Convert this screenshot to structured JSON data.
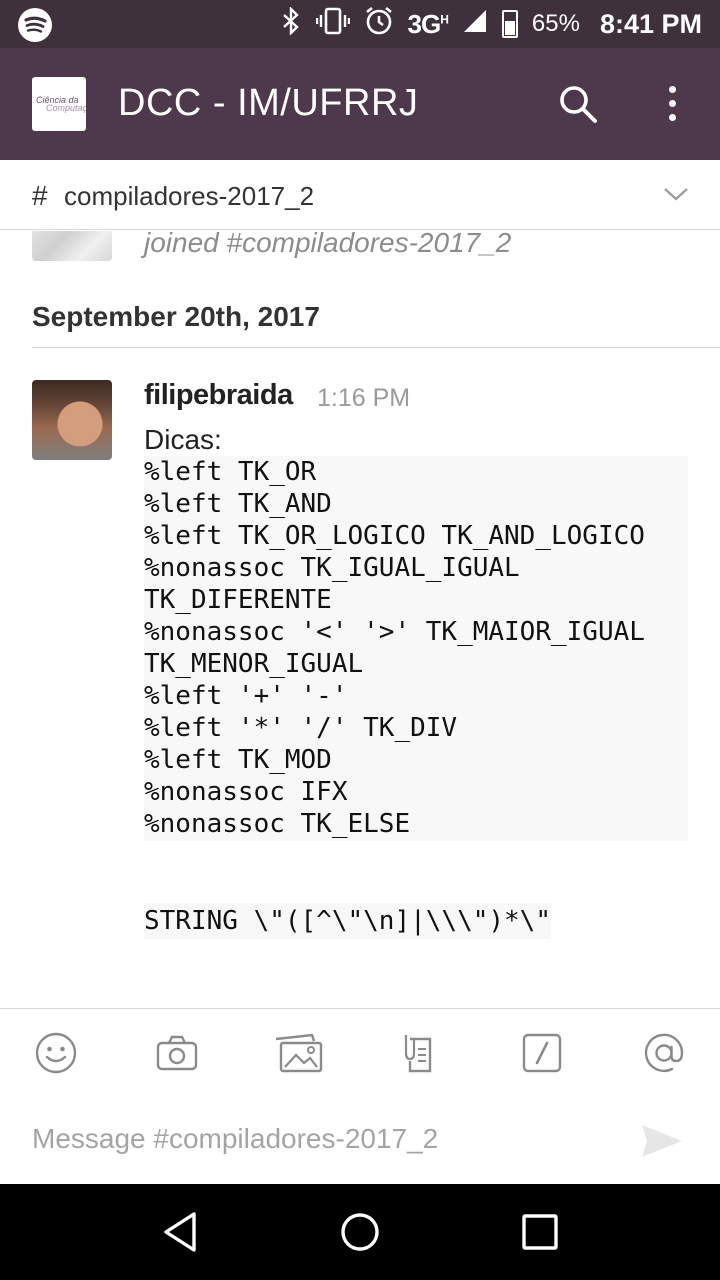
{
  "status_bar": {
    "network": "3G",
    "network_superscript": "H",
    "battery_percent": "65%",
    "time": "8:41 PM"
  },
  "app_bar": {
    "team_name": "DCC - IM/UFRRJ",
    "logo_text_1": "Ciência da",
    "logo_text_2": "Computação"
  },
  "channel": {
    "hash": "#",
    "name": "compiladores-2017_2"
  },
  "joined_message": {
    "text": "joined #compiladores-2017_2"
  },
  "date_divider": "September 20th, 2017",
  "message": {
    "author": "filipebraida",
    "time": "1:16 PM",
    "text": "Dicas:",
    "code_lines": [
      "%left TK_OR",
      "%left TK_AND",
      "%left TK_OR_LOGICO TK_AND_LOGICO",
      "%nonassoc TK_IGUAL_IGUAL",
      "TK_DIFERENTE",
      "%nonassoc '<' '>' TK_MAIOR_IGUAL",
      "TK_MENOR_IGUAL",
      "%left '+' '-'",
      "%left '*' '/' TK_DIV",
      "%left TK_MOD",
      "%nonassoc IFX",
      "%nonassoc TK_ELSE"
    ],
    "inline_code": "STRING \\\"([^\\\"\\n]|\\\\\\\")*\\\""
  },
  "composer": {
    "placeholder": "Message #compiladores-2017_2"
  }
}
